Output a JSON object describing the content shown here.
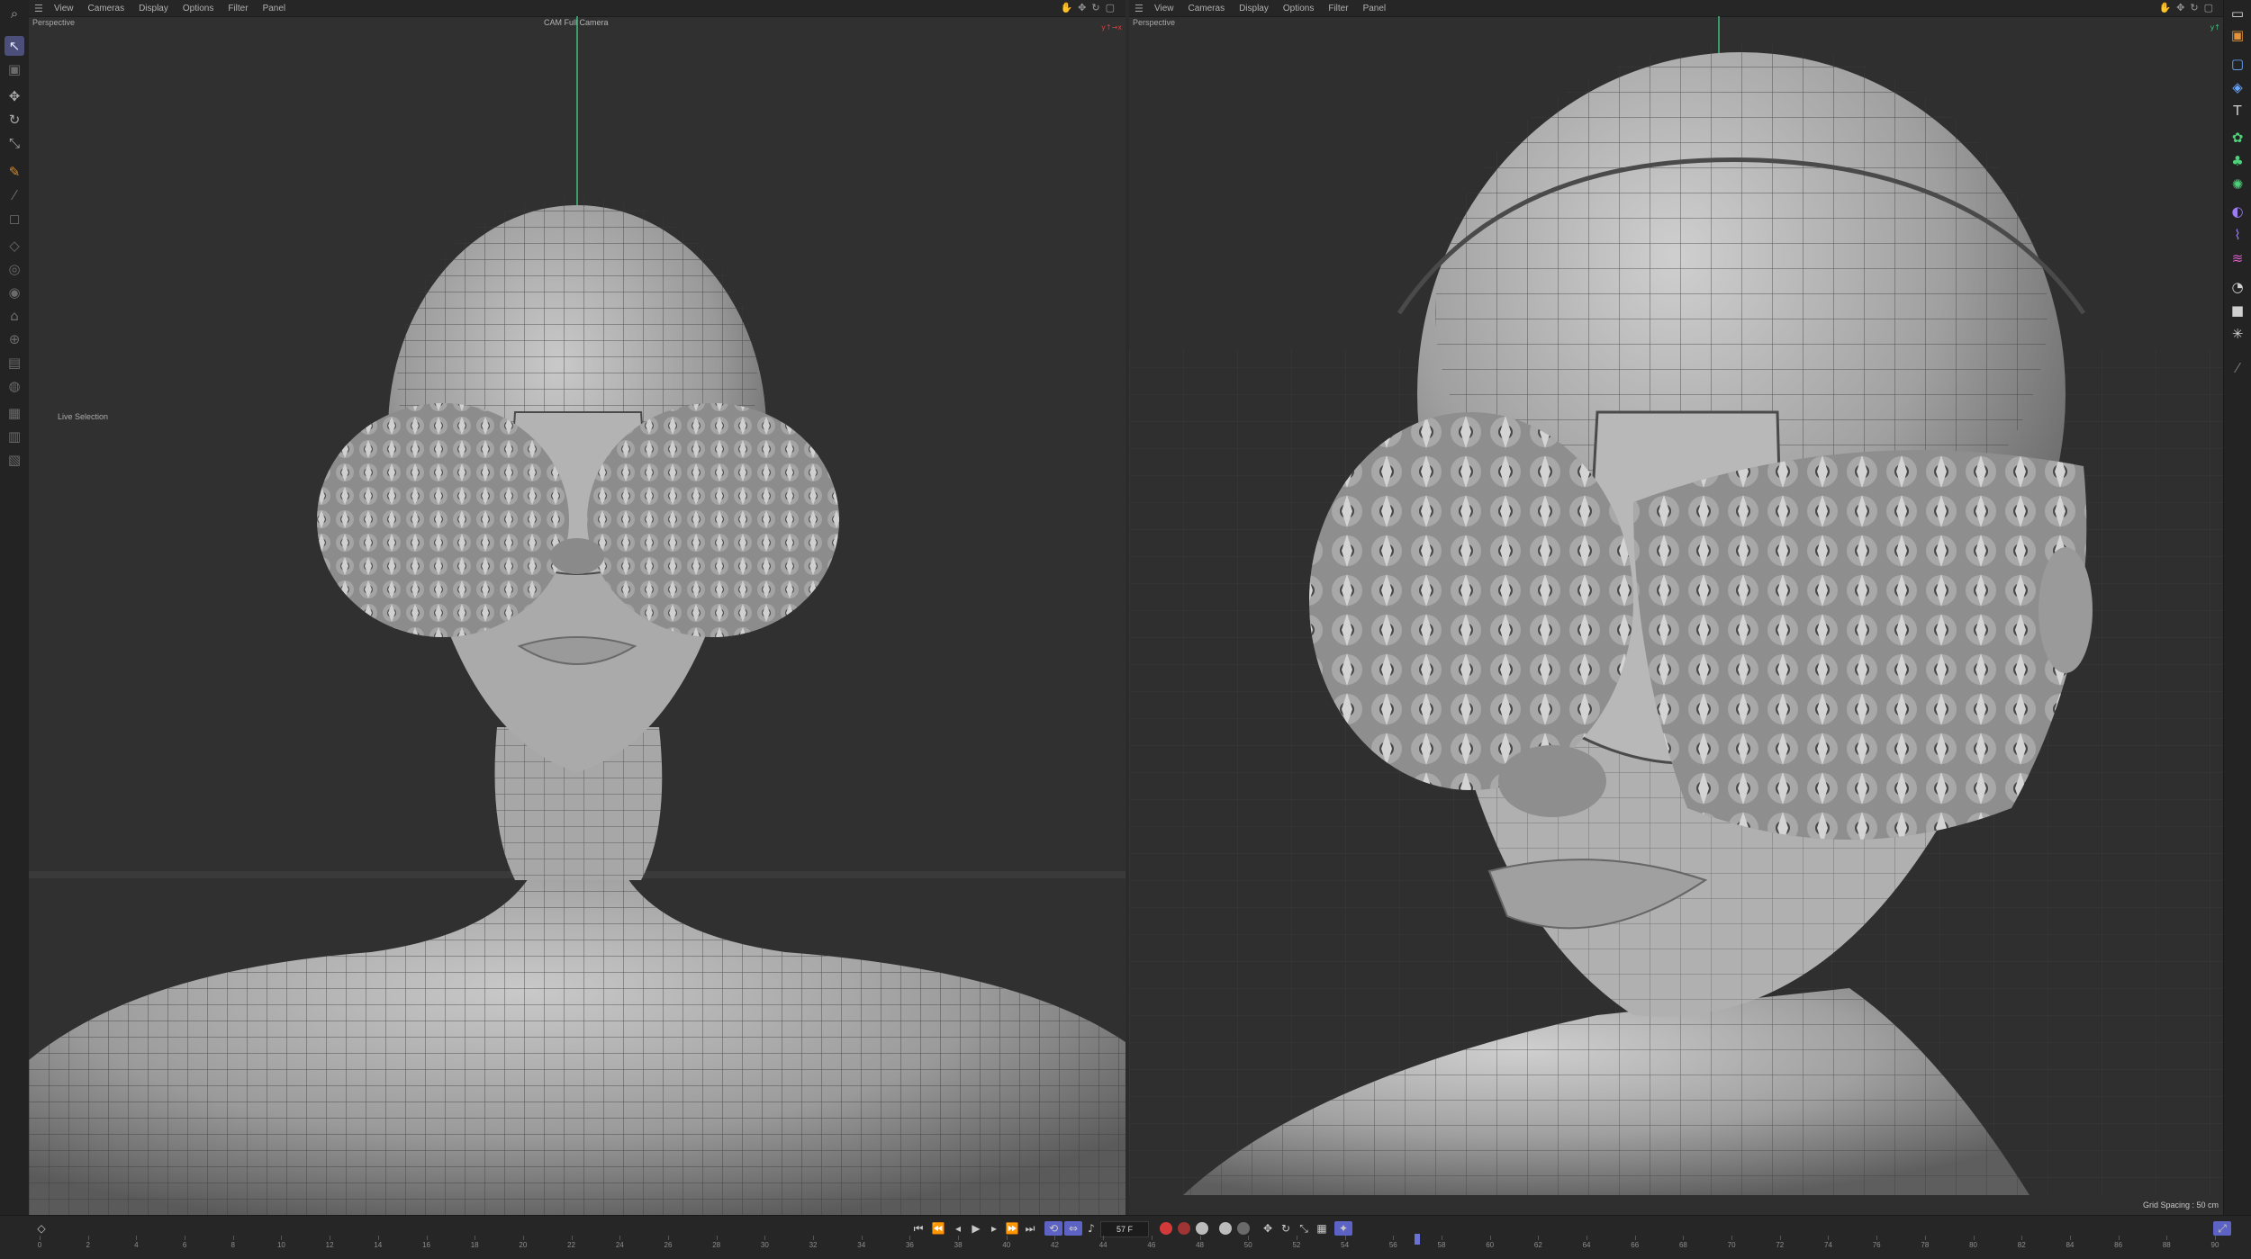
{
  "left_viewport": {
    "menu": [
      "View",
      "Cameras",
      "Display",
      "Options",
      "Filter",
      "Panel"
    ],
    "view_label": "Perspective",
    "camera_label": "CAM Full Camera",
    "tool_hint": "Live Selection"
  },
  "right_viewport": {
    "menu": [
      "View",
      "Cameras",
      "Display",
      "Options",
      "Filter",
      "Panel"
    ],
    "view_label": "Perspective",
    "grid_spacing": "Grid Spacing : 50 cm"
  },
  "timeline": {
    "current_frame": "57 F",
    "ticks": [
      "0",
      "2",
      "4",
      "6",
      "8",
      "10",
      "12",
      "14",
      "16",
      "18",
      "20",
      "22",
      "24",
      "26",
      "28",
      "30",
      "32",
      "34",
      "36",
      "38",
      "40",
      "42",
      "44",
      "46",
      "48",
      "50",
      "52",
      "54",
      "56",
      "58",
      "60",
      "62",
      "64",
      "66",
      "68",
      "70",
      "72",
      "74",
      "76",
      "78",
      "80",
      "82",
      "84",
      "86",
      "88",
      "90"
    ],
    "range_end": "90"
  },
  "colors": {
    "bg": "#2b2b2b",
    "accent": "#5c63c4",
    "record_red": "#d23a3a",
    "axis_green": "#3fbf7f",
    "axis_red": "#d04040"
  }
}
